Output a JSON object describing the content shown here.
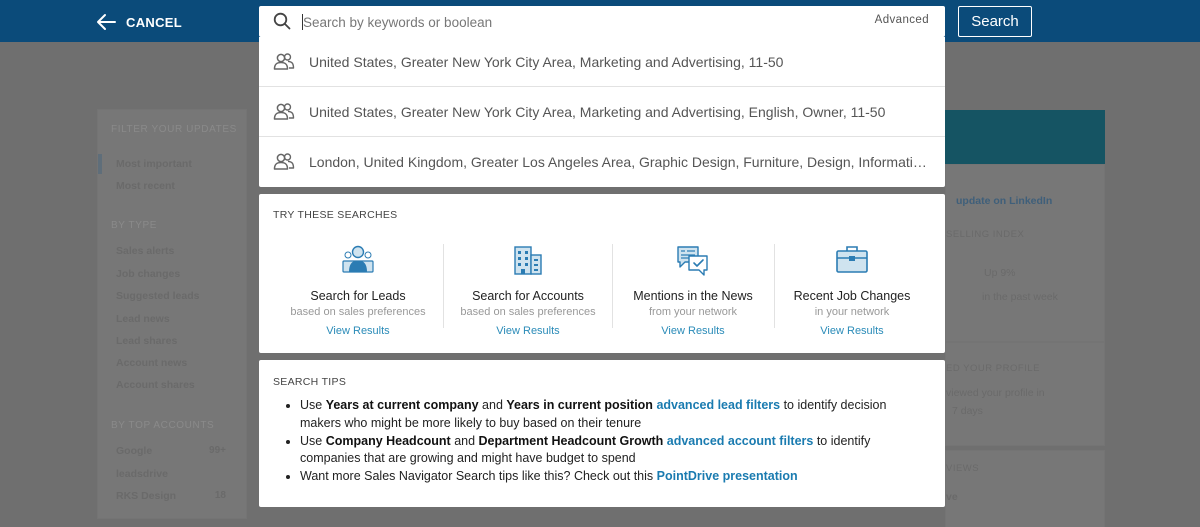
{
  "topbar": {
    "cancel_label": "CANCEL",
    "search_placeholder": "Search by keywords or boolean",
    "advanced_label": "Advanced",
    "search_button_label": "Search",
    "color": "#0b4b7a"
  },
  "suggestions": [
    {
      "icon": "people-icon",
      "text": "United States, Greater New York City Area, Marketing and Advertising, 11-50"
    },
    {
      "icon": "people-icon",
      "text": "United States, Greater New York City Area, Marketing and Advertising, English, Owner, 11-50"
    },
    {
      "icon": "people-icon",
      "text": "London, United Kingdom, Greater Los Angeles Area, Graphic Design, Furniture, Design, Informati…"
    }
  ],
  "try_searches": {
    "title": "TRY THESE SEARCHES",
    "cards": [
      {
        "icon": "lead-person-icon",
        "title": "Search for Leads",
        "subtitle": "based on sales preferences",
        "link": "View Results"
      },
      {
        "icon": "building-icon",
        "title": "Search for Accounts",
        "subtitle": "based on sales preferences",
        "link": "View Results"
      },
      {
        "icon": "news-chat-icon",
        "title": "Mentions in the News",
        "subtitle": "from your network",
        "link": "View Results"
      },
      {
        "icon": "briefcase-icon",
        "title": "Recent Job Changes",
        "subtitle": "in your network",
        "link": "View Results"
      }
    ]
  },
  "search_tips": {
    "title": "SEARCH TIPS",
    "tip1": {
      "a": "Use ",
      "b1": "Years at current company",
      "c": " and ",
      "b2": "Years in current position",
      "link": "advanced lead filters",
      "d": " to identify decision makers who might be more likely to buy based on their tenure"
    },
    "tip2": {
      "a": "Use ",
      "b1": "Company Headcount",
      "c": " and ",
      "b2": "Department Headcount Growth",
      "link": "advanced account filters",
      "d": " to identify companies that are growing and might have budget to spend"
    },
    "tip3": {
      "a": "Want more Sales Navigator Search tips like this? Check out this ",
      "link": "PointDrive presentation"
    }
  },
  "background": {
    "left_panel": {
      "header": "FILTER YOUR UPDATES",
      "items_top": [
        "Most important",
        "Most recent"
      ],
      "by_type_header": "BY TYPE",
      "by_type": [
        "Sales alerts",
        "Job changes",
        "Suggested leads",
        "Lead news",
        "Lead shares",
        "Account news",
        "Account shares"
      ],
      "by_account_header": "BY TOP ACCOUNTS",
      "accounts": [
        {
          "name": "Google",
          "count": "99+"
        },
        {
          "name": "leadsdrive",
          "count": ""
        },
        {
          "name": "RKS Design",
          "count": "18"
        }
      ]
    },
    "right_panel": {
      "share_link": "update on LinkedIn",
      "ssi_label": "SELLING INDEX",
      "ssi_change": "Up 9%",
      "ssi_period": "in the past week",
      "viewed_title": "ED YOUR PROFILE",
      "viewed_line1": "viewed your profile in",
      "viewed_line2": "7 days",
      "views_label": "VIEWS",
      "views_value": "ve"
    }
  }
}
